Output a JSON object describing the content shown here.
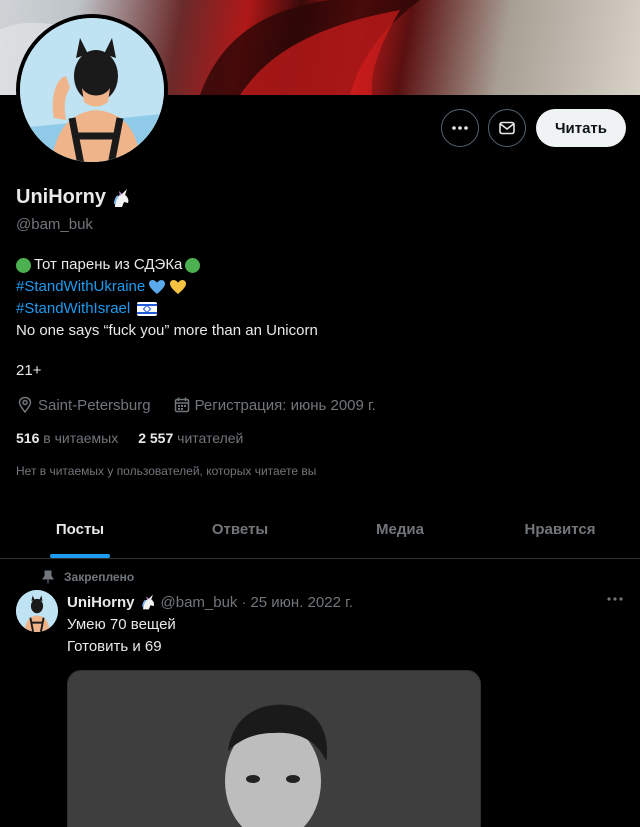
{
  "profile": {
    "name": "UniHorny",
    "handle": "@bam_buk",
    "bio": {
      "line1": "Тот парень из СДЭКа",
      "hashtag1": "#StandWithUkraine",
      "hashtag2": "#StandWithIsrael",
      "line4": "No one says “fuck you” more than an Unicorn",
      "age": "21+"
    },
    "location": "Saint-Petersburg",
    "joined": "Регистрация: июнь 2009 г.",
    "following_count": "516",
    "following_label": "в читаемых",
    "followers_count": "2 557",
    "followers_label": "читателей",
    "mutual_note": "Нет в читаемых у пользователей, которых читаете вы"
  },
  "actions": {
    "follow_label": "Читать",
    "more_icon": "more-icon",
    "message_icon": "mail-icon"
  },
  "tabs": [
    {
      "label": "Посты",
      "active": true
    },
    {
      "label": "Ответы",
      "active": false
    },
    {
      "label": "Медиа",
      "active": false
    },
    {
      "label": "Нравится",
      "active": false
    }
  ],
  "pinned_post": {
    "pinned_label": "Закреплено",
    "author_name": "UniHorny",
    "author_handle": "@bam_buk",
    "separator": "·",
    "date": "25 июн. 2022 г.",
    "line1": "Умею 70 вещей",
    "line2": "Готовить и 69"
  },
  "colors": {
    "accent": "#1d9bf0",
    "background": "#000000",
    "text": "#e7e9ea",
    "muted": "#71767b"
  }
}
